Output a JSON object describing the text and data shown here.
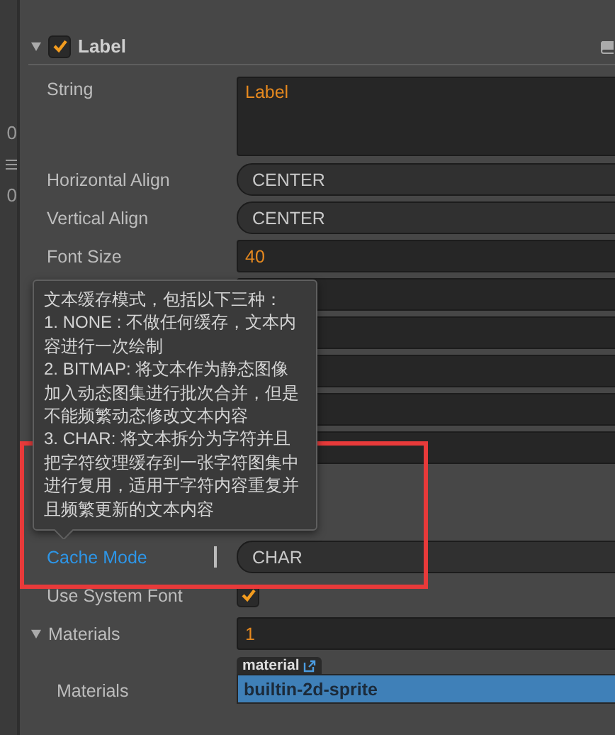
{
  "left_strip": {
    "texts": [
      "0",
      "0"
    ]
  },
  "component": {
    "title": "Label",
    "enabled": true,
    "expanded": true
  },
  "properties": [
    {
      "kind": "textarea",
      "label": "String",
      "value": "Label"
    },
    {
      "kind": "select",
      "label": "Horizontal Align",
      "value": "CENTER"
    },
    {
      "kind": "select",
      "label": "Vertical Align",
      "value": "CENTER"
    },
    {
      "kind": "number",
      "label": "Font Size",
      "value": "40"
    },
    {
      "kind": "blank"
    },
    {
      "kind": "blank"
    },
    {
      "kind": "blank"
    },
    {
      "kind": "blank"
    },
    {
      "kind": "blank"
    },
    {
      "kind": "empty"
    },
    {
      "kind": "empty"
    },
    {
      "kind": "select",
      "label": "Cache Mode",
      "value": "CHAR",
      "hovered": true
    },
    {
      "kind": "checkbox",
      "label": "Use System Font",
      "checked": true
    },
    {
      "kind": "array",
      "label": "Materials",
      "value": "1",
      "expanded": true
    },
    {
      "kind": "asset",
      "label": "Materials",
      "tag": "material",
      "value": "builtin-2d-sprite"
    }
  ],
  "tooltip": {
    "lines": [
      "文本缓存模式，包括以下三种：",
      "1. NONE : 不做任何缓存，文本内",
      "容进行一次绘制",
      "2. BITMAP: 将文本作为静态图像",
      "加入动态图集进行批次合并，但是",
      "不能频繁动态修改文本内容",
      "3. CHAR: 将文本拆分为字符并且",
      "把字符纹理缓存到一张字符图集中",
      "进行复用，适用于字符内容重复并",
      "且频繁更新的文本内容"
    ]
  }
}
